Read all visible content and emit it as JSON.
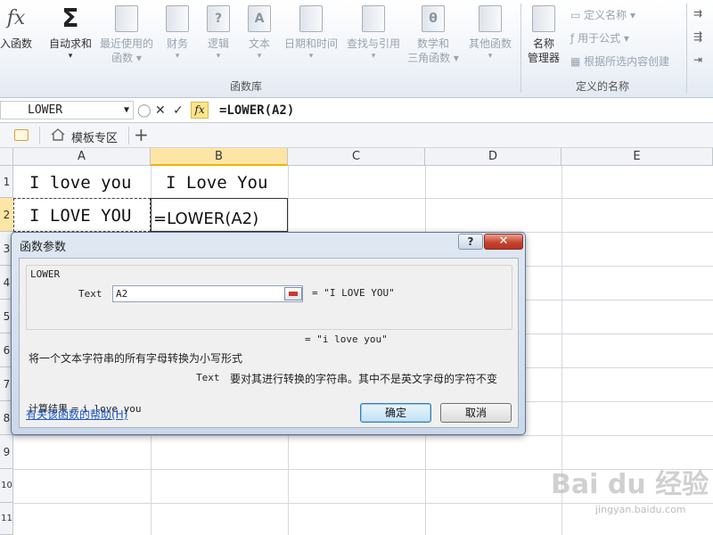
{
  "ribbon": {
    "buttons": [
      {
        "label": "入函数",
        "icon": "fx-icon",
        "disabled": false
      },
      {
        "label": "自动求和",
        "icon": "sigma-icon",
        "disabled": false
      },
      {
        "label": "最近使用的",
        "label2": "函数",
        "icon": "book-icon",
        "disabled": true
      },
      {
        "label": "财务",
        "icon": "book-icon",
        "disabled": true
      },
      {
        "label": "逻辑",
        "icon": "book-icon",
        "disabled": true
      },
      {
        "label": "文本",
        "icon": "book-icon",
        "disabled": true
      },
      {
        "label": "日期和时间",
        "icon": "book-icon",
        "disabled": true
      },
      {
        "label": "查找与引用",
        "icon": "book-icon",
        "disabled": true
      },
      {
        "label": "数学和",
        "label2": "三角函数",
        "icon": "book-icon",
        "disabled": true
      },
      {
        "label": "其他函数",
        "icon": "book-icon",
        "disabled": true
      },
      {
        "label": "名称",
        "label2": "管理器",
        "icon": "name-manager-icon",
        "disabled": false
      }
    ],
    "icon_glyphs": {
      "fx": "fx",
      "sigma": "Σ",
      "question": "?",
      "A": "A",
      "theta": "θ"
    },
    "group_function_library": "函数库",
    "group_defined_names": "定义的名称",
    "define_name": "定义名称",
    "use_in_formula": "用于公式",
    "create_from_selection": "根据所选内容创建"
  },
  "formula_bar": {
    "name_box": "LOWER",
    "cancel_glyph": "✕",
    "confirm_glyph": "✓",
    "fx_label": "fx",
    "formula": "=LOWER(A2)"
  },
  "tabs": {
    "template_tab": "模板专区",
    "add_glyph": "+"
  },
  "grid": {
    "columns": [
      "A",
      "B",
      "C",
      "D",
      "E"
    ],
    "rows": [
      "1",
      "2",
      "3",
      "4",
      "5",
      "6",
      "7",
      "8",
      "9",
      "10",
      "11"
    ],
    "cells": {
      "A1": "I love you",
      "B1": "I Love You",
      "A2": "I LOVE YOU",
      "B2": "=LOWER(A2)"
    }
  },
  "dialog": {
    "title": "函数参数",
    "help_glyph": "?",
    "close_glyph": "✕",
    "function_name": "LOWER",
    "arg_label": "Text",
    "arg_value": "A2",
    "arg_evaluated": "= \"I LOVE YOU\"",
    "result_preview": "= \"i love you\"",
    "function_description": "将一个文本字符串的所有字母转换为小写形式",
    "arg_desc_name": "Text",
    "arg_description": "要对其进行转换的字符串。其中不是英文字母的字符不变",
    "calc_result_label": "计算结果 =",
    "calc_result_value": "i love you",
    "help_link": "有关该函数的帮助(H)",
    "ok": "确定",
    "cancel": "取消"
  },
  "watermark": {
    "brand": "Bai du 经验",
    "url": "jingyan.baidu.com"
  }
}
